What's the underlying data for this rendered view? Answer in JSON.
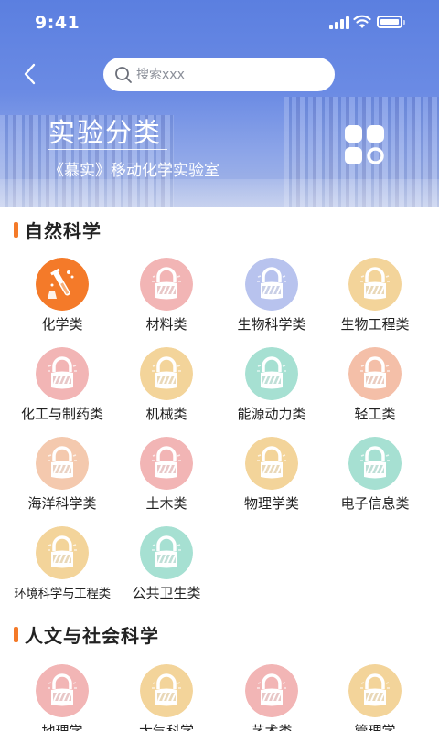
{
  "status": {
    "time": "9:41"
  },
  "header": {
    "search_placeholder": "搜索xxx",
    "title": "实验分类",
    "subtitle": "《慕实》移动化学实验室"
  },
  "sections": [
    {
      "title": "自然科学",
      "items": [
        {
          "label": "化学类",
          "color": "#f47a29",
          "locked": false
        },
        {
          "label": "材料类",
          "color": "#f2b5b5",
          "locked": true
        },
        {
          "label": "生物科学类",
          "color": "#b8c3ee",
          "locked": true
        },
        {
          "label": "生物工程类",
          "color": "#f3d49a",
          "locked": true
        },
        {
          "label": "化工与制药类",
          "color": "#f2b5b5",
          "locked": true
        },
        {
          "label": "机械类",
          "color": "#f3d49a",
          "locked": true
        },
        {
          "label": "能源动力类",
          "color": "#a6e0d2",
          "locked": true
        },
        {
          "label": "轻工类",
          "color": "#f4bfa8",
          "locked": true
        },
        {
          "label": "海洋科学类",
          "color": "#f4c9ae",
          "locked": true
        },
        {
          "label": "土木类",
          "color": "#f2b5b5",
          "locked": true
        },
        {
          "label": "物理学类",
          "color": "#f3d49a",
          "locked": true
        },
        {
          "label": "电子信息类",
          "color": "#a6e0d2",
          "locked": true
        },
        {
          "label": "环境科学与工程类",
          "color": "#f3d49a",
          "locked": true
        },
        {
          "label": "公共卫生类",
          "color": "#a6e0d2",
          "locked": true
        }
      ]
    },
    {
      "title": "人文与社会科学",
      "items": [
        {
          "label": "地理学",
          "color": "#f2b5b5",
          "locked": true
        },
        {
          "label": "大气科学",
          "color": "#f3d49a",
          "locked": true
        },
        {
          "label": "艺术类",
          "color": "#f2b5b5",
          "locked": true
        },
        {
          "label": "管理学",
          "color": "#f3d49a",
          "locked": true
        }
      ]
    }
  ]
}
